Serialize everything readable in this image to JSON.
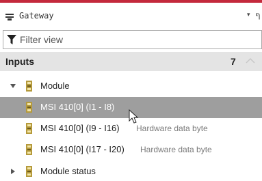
{
  "colors": {
    "accent": "#c4293c",
    "header_bg": "#e4e4e4",
    "selected_bg": "#9e9e9e",
    "module_icon": "#b59a3c"
  },
  "panel": {
    "title": "Gateway",
    "title_icon": "panel-menu-icon",
    "dropdown_glyph": "▾",
    "pin_glyph": "ף"
  },
  "filter": {
    "placeholder": "Filter view",
    "value": "",
    "icon": "filter-funnel-icon"
  },
  "section": {
    "label": "Inputs",
    "count": "7",
    "collapse_icon": "chevron-up-icon"
  },
  "tree": [
    {
      "label": "Module",
      "sub": "",
      "expanded": true,
      "level": 0
    },
    {
      "label": "MSI 410[0] (I1 - I8)",
      "sub": "",
      "selected": true,
      "level": 1
    },
    {
      "label": "MSI 410[0] (I9 - I16)",
      "sub": "Hardware data byte",
      "level": 1
    },
    {
      "label": "MSI 410[0] (I17 - I20)",
      "sub": "Hardware data byte",
      "level": 1
    },
    {
      "label": "Module status",
      "sub": "",
      "expanded": false,
      "level": 0
    }
  ]
}
